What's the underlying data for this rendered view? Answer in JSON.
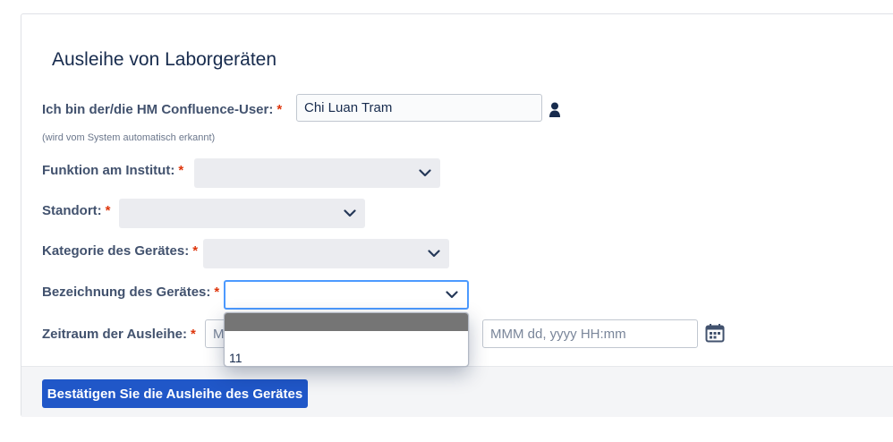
{
  "form": {
    "title": "Ausleihe von Laborgeräten",
    "required_marker": "*",
    "user": {
      "label": "Ich bin der/die HM Confluence-User:",
      "value": "Chi Luan Tram",
      "hint": "(wird vom System automatisch erkannt)",
      "icon": "user-icon"
    },
    "function": {
      "label": "Funktion am Institut:",
      "value": ""
    },
    "location": {
      "label": "Standort:",
      "value": ""
    },
    "category": {
      "label": "Kategorie des Gerätes:",
      "value": ""
    },
    "device_name": {
      "label": "Bezeichnung des Gerätes:",
      "value": "",
      "open": true,
      "options": [
        "",
        "11"
      ]
    },
    "period": {
      "label": "Zeitraum der Ausleihe:",
      "start_placeholder_visible": "M",
      "end_placeholder": "MMM dd, yyyy HH:mm",
      "icon": "calendar-icon"
    }
  },
  "footer": {
    "confirm_label": "Bestätigen Sie die Ausleihe des Gerätes"
  },
  "colors": {
    "required": "#de350b",
    "primary_button": "#2057c8",
    "focus_border": "#4c9aff",
    "select_bg": "#ebecf0"
  }
}
